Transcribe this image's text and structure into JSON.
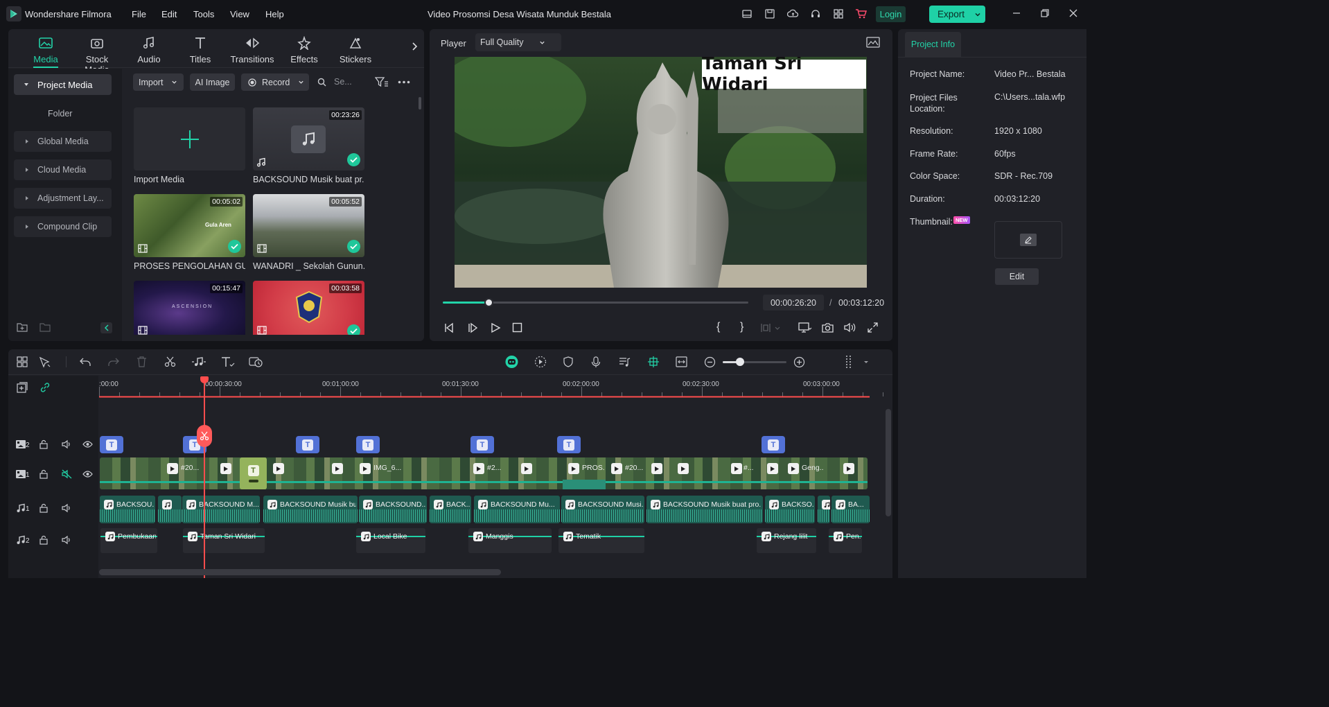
{
  "app": {
    "name": "Wondershare Filmora",
    "project_title": "Video Prosomsi Desa Wisata Munduk Bestala"
  },
  "menu": [
    "File",
    "Edit",
    "Tools",
    "View",
    "Help"
  ],
  "header": {
    "login_label": "Login",
    "export_label": "Export"
  },
  "media_tabs": [
    {
      "label": "Media",
      "icon": "media-icon"
    },
    {
      "label": "Stock Media",
      "icon": "stock-media-icon"
    },
    {
      "label": "Audio",
      "icon": "audio-note-icon"
    },
    {
      "label": "Titles",
      "icon": "titles-t-icon"
    },
    {
      "label": "Transitions",
      "icon": "transitions-icon"
    },
    {
      "label": "Effects",
      "icon": "effects-icon"
    },
    {
      "label": "Stickers",
      "icon": "stickers-icon"
    }
  ],
  "sidebar": {
    "items": [
      "Project Media",
      "Folder",
      "Global Media",
      "Cloud Media",
      "Adjustment Lay...",
      "Compound Clip"
    ]
  },
  "media_toolbar": {
    "import": "Import",
    "ai_image": "AI Image",
    "record": "Record",
    "search_placeholder": "Se..."
  },
  "media_items": [
    {
      "label": "Import Media",
      "duration": ""
    },
    {
      "label": "BACKSOUND Musik buat pr...",
      "duration": "00:23:26"
    },
    {
      "label": "PROSES PENGOLAHAN GUL...",
      "duration": "00:05:02",
      "overlay_text": "Gula Aren"
    },
    {
      "label": "WANADRI _ Sekolah Gunun...",
      "duration": "00:05:52"
    },
    {
      "label": "",
      "duration": "00:15:47",
      "overlay_text": "ASCENSION"
    },
    {
      "label": "",
      "duration": "00:03:58"
    }
  ],
  "player": {
    "label": "Player",
    "quality": "Full Quality",
    "overlay_title": "Taman Sri Widari",
    "current_time": "00:00:26:20",
    "separator": "/",
    "total_time": "00:03:12:20",
    "progress": 0.15
  },
  "project_info": {
    "tab": "Project Info",
    "fields": [
      {
        "key": "Project Name:",
        "value": "Video Pr... Bestala"
      },
      {
        "key": "Project Files Location:",
        "value": "C:\\Users...tala.wfp"
      },
      {
        "key": "Resolution:",
        "value": "1920 x 1080"
      },
      {
        "key": "Frame Rate:",
        "value": "60fps"
      },
      {
        "key": "Color Space:",
        "value": "SDR - Rec.709"
      },
      {
        "key": "Duration:",
        "value": "00:03:12:20"
      }
    ],
    "thumbnail_label": "Thumbnail:",
    "new_badge": "NEW",
    "edit_label": "Edit"
  },
  "timeline": {
    "ruler": [
      ":00:00",
      "00:00:30:00",
      "00:01:00:00",
      "00:01:30:00",
      "00:02:00:00",
      "00:02:30:00",
      "00:03:00:00"
    ],
    "tracks": [
      {
        "num": "2",
        "type": "video"
      },
      {
        "num": "1",
        "type": "video"
      },
      {
        "num": "1",
        "type": "audio"
      },
      {
        "num": "2",
        "type": "audio"
      }
    ],
    "video_labels": [
      "#20...",
      "IMG_6...",
      "#2...",
      "PROS...",
      "#20...",
      "#...",
      "Geng..."
    ],
    "audio1_labels": [
      "BACKSOU...",
      "BACKSOUND M...",
      "BACKSOUND Musik bu...",
      "BACKSOUND...",
      "BACK...",
      "BACKSOUND Mu...",
      "BACKSOUND Musi...",
      "BACKSOUND Musik buat pro...",
      "BACKSO...",
      "BA..."
    ],
    "audio2_labels": [
      "Pembukaan",
      "Taman Sri Widari",
      "Local Bike",
      "Manggis",
      "Tematik",
      "Rejang lilit",
      "Pen..."
    ]
  },
  "colors": {
    "accent": "#1fd1a6",
    "playhead": "#ff4d4d",
    "title_clip": "#5271d6",
    "audio_clip": "#1f5a50"
  }
}
